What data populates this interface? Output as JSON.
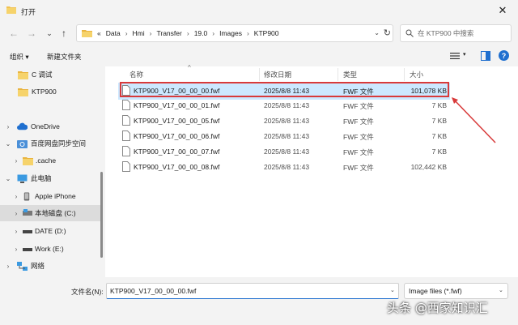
{
  "window": {
    "title": "打开"
  },
  "nav": {
    "back": "←",
    "forward": "→",
    "down": "⌄",
    "up": "↑"
  },
  "address": {
    "prefix": "«",
    "crumbs": [
      "Data",
      "Hmi",
      "Transfer",
      "19.0",
      "Images",
      "KTP900"
    ],
    "separator": "›"
  },
  "search": {
    "placeholder": "在 KTP900 中搜索"
  },
  "toolbar": {
    "organize": "组织 ▾",
    "new_folder": "新建文件夹"
  },
  "sidebar": {
    "items": [
      {
        "label": "C 调试",
        "icon": "folder-icon"
      },
      {
        "label": "KTP900",
        "icon": "folder-icon"
      },
      {
        "label": "OneDrive",
        "icon": "cloud-icon",
        "chevron": "›"
      },
      {
        "label": "百度网盘同步空间",
        "icon": "sync-folder-icon",
        "chevron": "⌄"
      },
      {
        "label": ".cache",
        "icon": "folder-icon",
        "chevron": "›"
      },
      {
        "label": "此电脑",
        "icon": "computer-icon",
        "chevron": "⌄"
      },
      {
        "label": "Apple iPhone",
        "icon": "phone-icon",
        "chevron": "›"
      },
      {
        "label": "本地磁盘 (C:)",
        "icon": "drive-icon",
        "chevron": "›"
      },
      {
        "label": "DATE (D:)",
        "icon": "drive-icon",
        "chevron": "›"
      },
      {
        "label": "Work (E:)",
        "icon": "drive-icon",
        "chevron": "›"
      },
      {
        "label": "网络",
        "icon": "network-icon",
        "chevron": "›"
      }
    ]
  },
  "columns": {
    "name": "名称",
    "date": "修改日期",
    "type": "类型",
    "size": "大小"
  },
  "files": [
    {
      "name": "KTP900_V17_00_00_00.fwf",
      "date": "2025/8/8 11:43",
      "type": "FWF 文件",
      "size": "101,078 KB",
      "selected": true
    },
    {
      "name": "KTP900_V17_00_00_01.fwf",
      "date": "2025/8/8 11:43",
      "type": "FWF 文件",
      "size": "7 KB"
    },
    {
      "name": "KTP900_V17_00_00_05.fwf",
      "date": "2025/8/8 11:43",
      "type": "FWF 文件",
      "size": "7 KB"
    },
    {
      "name": "KTP900_V17_00_00_06.fwf",
      "date": "2025/8/8 11:43",
      "type": "FWF 文件",
      "size": "7 KB"
    },
    {
      "name": "KTP900_V17_00_00_07.fwf",
      "date": "2025/8/8 11:43",
      "type": "FWF 文件",
      "size": "7 KB"
    },
    {
      "name": "KTP900_V17_00_00_08.fwf",
      "date": "2025/8/8 11:43",
      "type": "FWF 文件",
      "size": "102,442 KB"
    }
  ],
  "footer": {
    "filename_label": "文件名(N):",
    "filename_value": "KTP900_V17_00_00_00.fwf",
    "filetype_value": "Image files (*.fwf)"
  },
  "watermark": "头条 @西家知识汇",
  "colors": {
    "selection": "#cce8ff",
    "annotation": "#d83a3a",
    "accent": "#1f6fcf"
  }
}
